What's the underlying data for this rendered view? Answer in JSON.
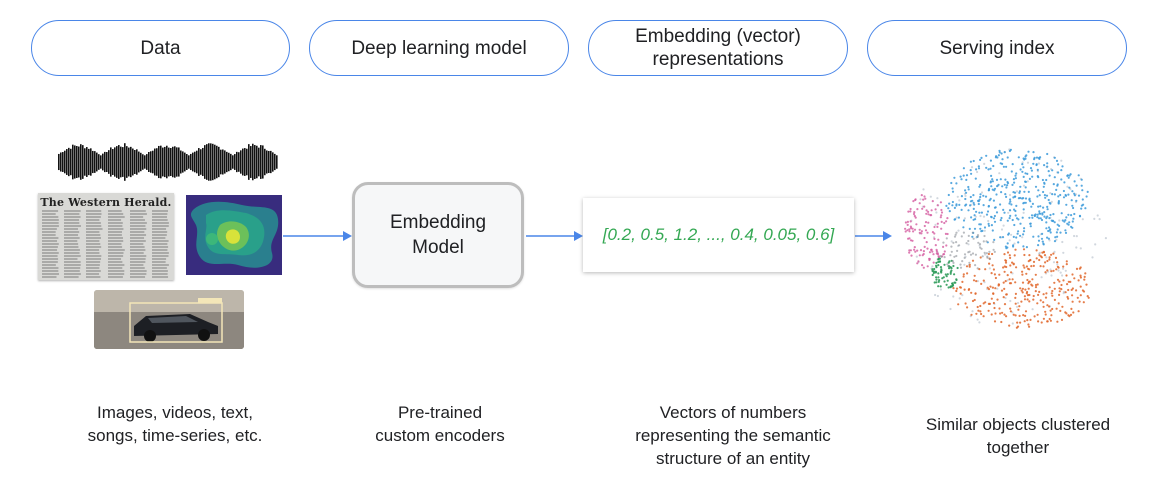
{
  "headers": {
    "data": "Data",
    "model": "Deep learning model",
    "embedding": "Embedding (vector)\nrepresentations",
    "index": "Serving index"
  },
  "model_box": {
    "label": "Embedding\nModel"
  },
  "vector": {
    "text": "[0.2, 0.5, 1.2, ..., 0.4, 0.05, 0.6]",
    "color": "#34a853"
  },
  "newspaper": {
    "title": "The Western Herald."
  },
  "captions": {
    "data": "Images, videos, text,\nsongs, time-series, etc.",
    "model": "Pre-trained\ncustom encoders",
    "embedding": "Vectors of numbers\nrepresenting the semantic\nstructure of an entity",
    "index": "Similar objects clustered\ntogether"
  },
  "colors": {
    "accent": "#4a86e8",
    "cluster_blue": "#3b9ad9",
    "cluster_orange": "#e0662a",
    "cluster_pink": "#d45da0",
    "cluster_green": "#2e9b5a"
  }
}
